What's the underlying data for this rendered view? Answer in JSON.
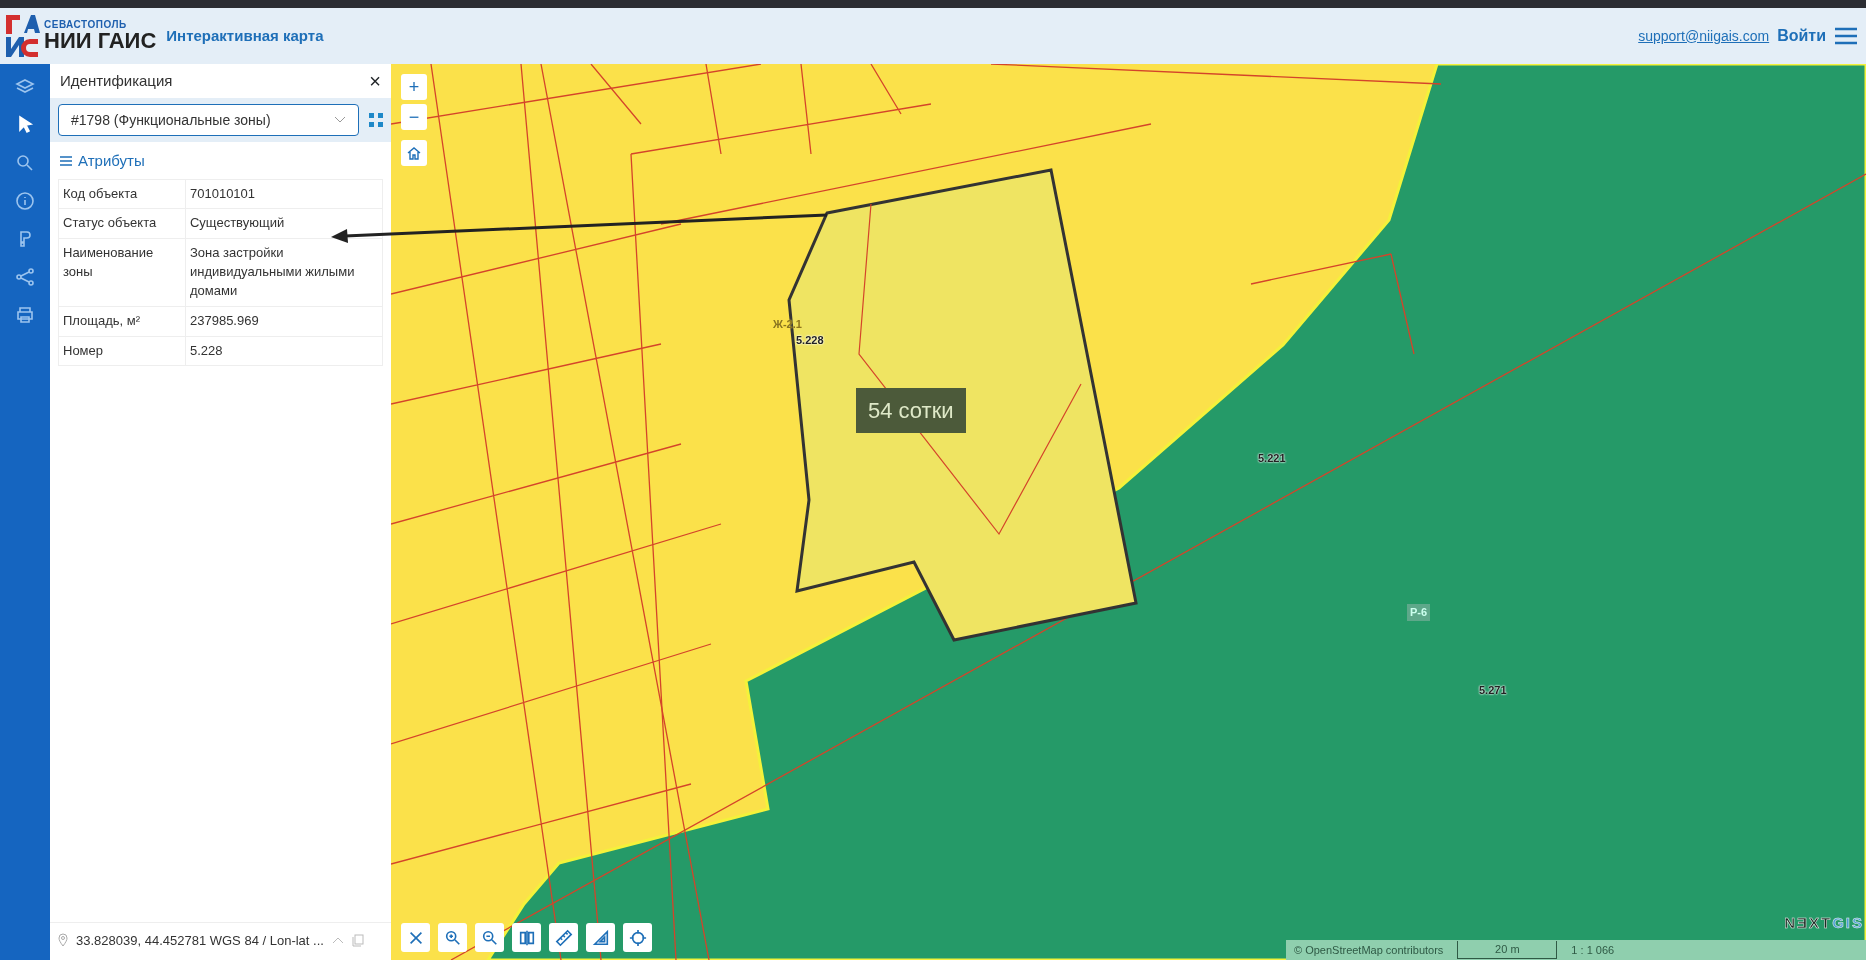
{
  "header": {
    "logo_small": "СЕВАСТОПОЛЬ",
    "logo_big": "НИИ ГАИС",
    "title": "Интерактивная карта",
    "support": "support@niigais.com",
    "login": "Войти"
  },
  "sidebar": {
    "items": [
      {
        "kind": "layers",
        "selected": false
      },
      {
        "kind": "pointer",
        "selected": true
      },
      {
        "kind": "search",
        "selected": false
      },
      {
        "kind": "info",
        "selected": false
      },
      {
        "kind": "plugin",
        "selected": false
      },
      {
        "kind": "share",
        "selected": false
      },
      {
        "kind": "print",
        "selected": false
      }
    ]
  },
  "panel": {
    "title": "Идентификация",
    "close": "×",
    "select": {
      "value": "#1798 (Функциональные зоны)"
    },
    "section": "Атрибуты",
    "rows": [
      {
        "label": "Код объекта",
        "value": "701010101"
      },
      {
        "label": "Статус объекта",
        "value": "Существующий"
      },
      {
        "label": "Наименование зоны",
        "value": "Зона застройки индивидуальными жилыми домами"
      },
      {
        "label": "Площадь, м²",
        "value": "237985.969"
      },
      {
        "label": "Номер",
        "value": "5.228"
      }
    ],
    "coordinates": "33.828039, 44.452781 WGS 84 / Lon-lat ..."
  },
  "map": {
    "zoom_in": "+",
    "zoom_out": "−",
    "labels": [
      {
        "text": "Ж-2.1",
        "kind": "faint"
      },
      {
        "text": "5.228",
        "kind": "number"
      },
      {
        "text": "5.221",
        "kind": "number"
      },
      {
        "text": "Р-6",
        "kind": "zone"
      },
      {
        "text": "5.271",
        "kind": "number"
      }
    ],
    "annotation": "54 сотки",
    "tools": [
      {
        "kind": "clear"
      },
      {
        "kind": "zoom-in"
      },
      {
        "kind": "zoom-out"
      },
      {
        "kind": "swipe"
      },
      {
        "kind": "ruler"
      },
      {
        "kind": "area"
      },
      {
        "kind": "locate"
      }
    ],
    "brand": {
      "a": "N",
      "b": "Ǝ",
      "c": "XT",
      "d": "GIS"
    },
    "attribution": "© OpenStreetMap contributors",
    "scale": "20 m",
    "ratio": "1 : 1 066"
  }
}
